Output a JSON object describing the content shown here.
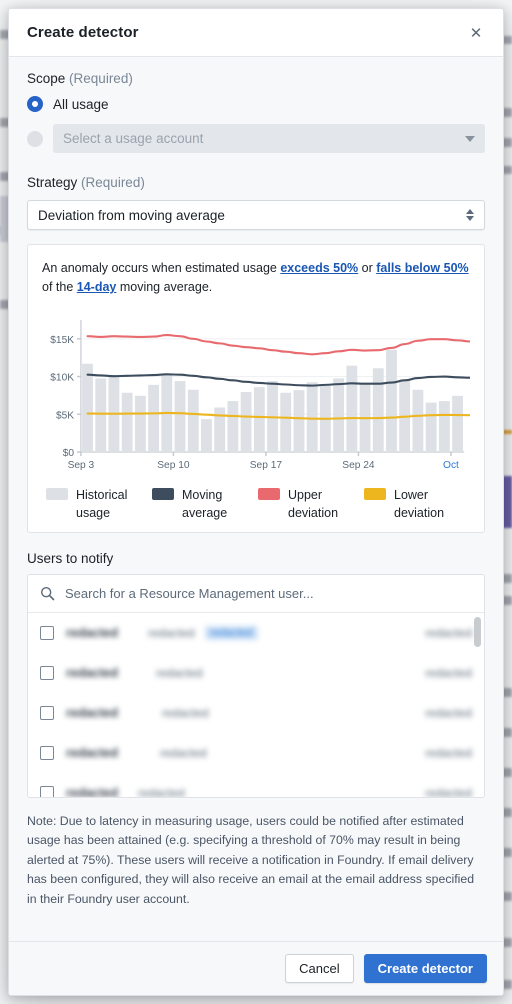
{
  "modal": {
    "title": "Create detector",
    "close_icon": "close-icon"
  },
  "scope": {
    "label": "Scope",
    "required_suffix": "(Required)",
    "option_all_usage": "All usage",
    "account_placeholder": "Select a usage account"
  },
  "strategy": {
    "label": "Strategy",
    "required_suffix": "(Required)",
    "selected": "Deviation from moving average"
  },
  "anomaly": {
    "text_1": "An anomaly occurs when estimated usage ",
    "link_exceeds": "exceeds 50%",
    "text_2": " or ",
    "link_falls": "falls below 50%",
    "text_3": " of the ",
    "link_window": "14-day",
    "text_4": " moving average."
  },
  "chart_data": {
    "type": "bar",
    "title": "",
    "xlabel": "",
    "ylabel": "",
    "ylim": [
      0,
      17500
    ],
    "ytick_labels": [
      "$15K",
      "$10K",
      "$5K",
      "$0"
    ],
    "ytick_values": [
      15000,
      10000,
      5000,
      0
    ],
    "xtick_labels": [
      "Sep 3",
      "Sep 10",
      "Sep 17",
      "Sep 24",
      "Oct"
    ],
    "xtick_indices": [
      0,
      7,
      14,
      21,
      28
    ],
    "xtick_highlight": "Oct",
    "grid": true,
    "legend_position": "bottom",
    "colors": {
      "historical": "#dde1e5",
      "moving_average": "#3d4d5e",
      "upper_deviation": "#e86a6e",
      "lower_deviation": "#edb51e",
      "axis": "#5c6b7a",
      "highlight": "#2b7ad6"
    },
    "categories": [
      "Sep 3",
      "Sep 4",
      "Sep 5",
      "Sep 6",
      "Sep 7",
      "Sep 8",
      "Sep 9",
      "Sep 10",
      "Sep 11",
      "Sep 12",
      "Sep 13",
      "Sep 14",
      "Sep 15",
      "Sep 16",
      "Sep 17",
      "Sep 18",
      "Sep 19",
      "Sep 20",
      "Sep 21",
      "Sep 22",
      "Sep 23",
      "Sep 24",
      "Sep 25",
      "Sep 26",
      "Sep 27",
      "Sep 28",
      "Sep 29",
      "Sep 30",
      "Oct 1",
      "Oct 2"
    ],
    "series": [
      {
        "name": "Historical usage",
        "type": "bar",
        "color": "#dde1e5",
        "values": [
          11700,
          9750,
          10150,
          7850,
          7450,
          8900,
          10150,
          9400,
          8250,
          4350,
          5900,
          6750,
          7950,
          8600,
          9400,
          7850,
          8200,
          9250,
          8750,
          9750,
          11450,
          9050,
          11100,
          13550,
          9500,
          8250,
          6550,
          6750,
          7450
        ]
      },
      {
        "name": "Moving average",
        "type": "line",
        "color": "#3d4d5e",
        "values": [
          10250,
          10150,
          10050,
          10100,
          10150,
          10200,
          10300,
          10250,
          10100,
          9900,
          9700,
          9500,
          9300,
          9150,
          9050,
          8950,
          8850,
          8800,
          8900,
          9000,
          9100,
          9050,
          9050,
          9200,
          9500,
          9800,
          9950,
          10000,
          9900,
          9850
        ]
      },
      {
        "name": "Upper deviation",
        "type": "line",
        "color": "#e86a6e",
        "values": [
          15350,
          15250,
          15350,
          15300,
          15250,
          15300,
          15500,
          15350,
          15000,
          14650,
          14400,
          14100,
          13900,
          13750,
          13500,
          13300,
          13100,
          12950,
          13100,
          13350,
          13550,
          13450,
          13500,
          13800,
          14300,
          14750,
          14950,
          14950,
          14800,
          14650
        ]
      },
      {
        "name": "Lower deviation",
        "type": "line",
        "color": "#edb51e",
        "values": [
          5100,
          5080,
          5070,
          5090,
          5100,
          5120,
          5180,
          5150,
          5050,
          4950,
          4850,
          4780,
          4700,
          4650,
          4600,
          4550,
          4480,
          4420,
          4400,
          4450,
          4500,
          4480,
          4500,
          4560,
          4680,
          4800,
          4880,
          4920,
          4900,
          4880
        ]
      }
    ],
    "legend": [
      {
        "label": "Historical usage",
        "color": "#dde1e5"
      },
      {
        "label": "Moving average",
        "color": "#3d4d5e"
      },
      {
        "label": "Upper deviation",
        "color": "#e86a6e"
      },
      {
        "label": "Lower deviation",
        "color": "#edb51e"
      }
    ]
  },
  "users": {
    "label": "Users to notify",
    "search_placeholder": "Search for a Resource Management user...",
    "search_value": "",
    "search_icon": "search-icon",
    "rows": [
      {
        "name": "redacted",
        "username": "redacted",
        "tag": "redacted",
        "org": "redacted"
      },
      {
        "name": "redacted",
        "username": "redacted",
        "tag": "",
        "org": "redacted"
      },
      {
        "name": "redacted",
        "username": "redacted",
        "tag": "",
        "org": "redacted"
      },
      {
        "name": "redacted",
        "username": "redacted",
        "tag": "",
        "org": "redacted"
      },
      {
        "name": "redacted",
        "username": "redacted",
        "tag": "",
        "org": "redacted"
      }
    ]
  },
  "note": "Note: Due to latency in measuring usage, users could be notified after estimated usage has been attained (e.g. specifying a threshold of 70% may result in being alerted at 75%). These users will receive a notification in Foundry. If email delivery has been configured, they will also receive an email at the email address specified in their Foundry user account.",
  "footer": {
    "cancel_label": "Cancel",
    "submit_label": "Create detector"
  }
}
